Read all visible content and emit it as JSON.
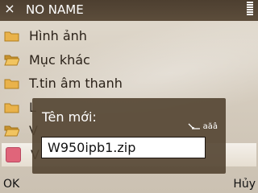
{
  "header": {
    "title": "NO NAME",
    "close_glyph": "×"
  },
  "list": {
    "items": [
      {
        "label": "Hình ảnh",
        "icon": "folder-closed-icon"
      },
      {
        "label": "Mục khác",
        "icon": "folder-open-icon"
      },
      {
        "label": "T.tin âm thanh",
        "icon": "folder-closed-icon"
      },
      {
        "label": "L",
        "icon": "folder-closed-icon"
      },
      {
        "label": "V",
        "icon": "folder-open-icon"
      },
      {
        "label": "V",
        "icon": "app-file-icon"
      }
    ]
  },
  "dialog": {
    "label": "Tên mới:",
    "input_mode": "aăâ",
    "input_value": "W950ipb1.zip"
  },
  "softkeys": {
    "left": "OK",
    "right": "Hủy"
  },
  "colors": {
    "header_bg": "#4d3f30",
    "dialog_bg": "#564634",
    "folder": "#e9b24a",
    "app_icon": "#e0657a"
  }
}
